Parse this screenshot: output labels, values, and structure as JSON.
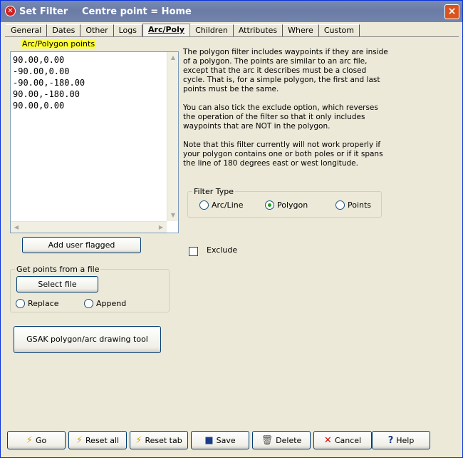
{
  "window": {
    "title": "Set Filter",
    "subtitle": "Centre point = Home",
    "close_label": "×"
  },
  "tabs": [
    {
      "label": "General"
    },
    {
      "label": "Dates"
    },
    {
      "label": "Other"
    },
    {
      "label": "Logs"
    },
    {
      "label": "Arc/Poly"
    },
    {
      "label": "Children"
    },
    {
      "label": "Attributes"
    },
    {
      "label": "Where"
    },
    {
      "label": "Custom"
    }
  ],
  "active_tab": "Arc/Poly",
  "points": {
    "label": "Arc/Polygon points",
    "lines": [
      "90.00,0.00",
      "-90.00,0.00",
      "-90.00,-180.00",
      "90.00,-180.00",
      "90.00,0.00"
    ]
  },
  "add_user_flagged": "Add user flagged",
  "file_group": {
    "legend": "Get points from a file",
    "select_file": "Select file",
    "replace": "Replace",
    "append": "Append"
  },
  "drawing_tool": "GSAK polygon/arc drawing tool",
  "description": {
    "p1": "The polygon filter includes waypoints if they are inside of a polygon.  The points are similar to an arc file, except that the arc it describes must be a closed cycle.  That is, for a simple polygon, the first and last points must be the same.",
    "p2": "You can also tick the exclude option, which reverses the operation of the filter so that it only includes waypoints that are NOT in the polygon.",
    "p3": "Note that this filter currently will not work properly if your polygon  contains one or both poles or if it spans the line of 180 degrees  east or west longitude."
  },
  "filter_type": {
    "legend": "Filter Type",
    "options": [
      "Arc/Line",
      "Polygon",
      "Points"
    ],
    "selected": "Polygon"
  },
  "exclude": {
    "label": "Exclude",
    "checked": false
  },
  "bottom_buttons": {
    "go": "Go",
    "reset_all": "Reset all",
    "reset_tab": "Reset tab",
    "save": "Save",
    "delete": "Delete",
    "cancel": "Cancel",
    "help": "Help"
  }
}
